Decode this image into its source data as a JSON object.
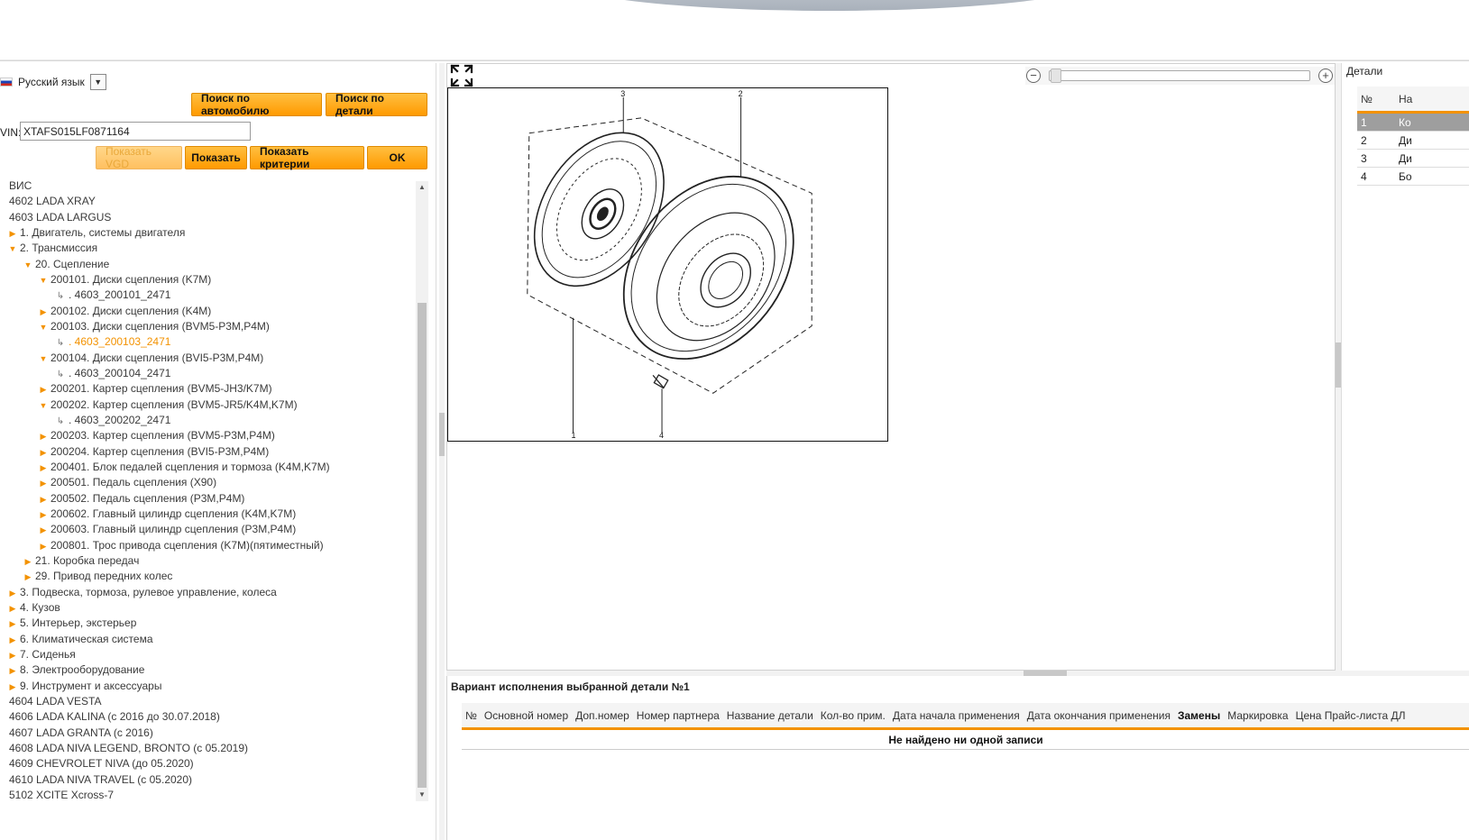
{
  "language": {
    "label": "Русский язык"
  },
  "search": {
    "by_car": "Поиск по автомобилю",
    "by_part": "Поиск по детали"
  },
  "vin": {
    "label": "VIN:",
    "value": "XTAFS015LF0871164"
  },
  "actions": {
    "show_vgd": "Показать VGD",
    "show": "Показать",
    "show_criteria": "Показать критерии",
    "ok": "OK"
  },
  "tree": {
    "items": [
      "ВИС",
      "4602 LADA XRAY",
      "4603 LADA LARGUS",
      "1. Двигатель, системы двигателя",
      "2. Трансмиссия",
      "20. Сцепление",
      "200101. Диски сцепления (K7M)",
      ". 4603_200101_2471",
      "200102. Диски сцепления (K4M)",
      "200103. Диски сцепления (BVM5-P3M,P4M)",
      ". 4603_200103_2471",
      "200104. Диски сцепления (BVI5-P3M,P4M)",
      ". 4603_200104_2471",
      "200201. Картер сцепления (BVM5-JH3/K7M)",
      "200202. Картер сцепления (BVM5-JR5/K4M,K7M)",
      ". 4603_200202_2471",
      "200203. Картер сцепления (BVM5-P3M,P4M)",
      "200204. Картер сцепления (BVI5-P3M,P4M)",
      "200401. Блок педалей сцепления и тормоза (K4M,K7M)",
      "200501. Педаль сцепления (X90)",
      "200502. Педаль сцепления (P3M,P4M)",
      "200602. Главный цилиндр сцепления (K4M,K7M)",
      "200603. Главный цилиндр сцепления (P3M,P4M)",
      "200801. Трос привода сцепления (K7M)(пятиместный)",
      "21. Коробка передач",
      "29. Привод передних колес",
      "3. Подвеска, тормоза, рулевое управление, колеса",
      "4. Кузов",
      "5. Интерьер, экстерьер",
      "6. Климатическая система",
      "7. Сиденья",
      "8. Электрооборудование",
      "9. Инструмент и аксессуары",
      "4604 LADA VESTA",
      "4606 LADA KALINA (с 2016 до 30.07.2018)",
      "4607 LADA GRANTA (с 2016)",
      "4608 LADA NIVA LEGEND, BRONTO (с 05.2019)",
      "4609 CHEVROLET NIVA (до 05.2020)",
      "4610 LADA NIVA TRAVEL (с 05.2020)",
      "5102 XCITE Xcross-7"
    ]
  },
  "zoom": {
    "minus": "−",
    "plus": "+"
  },
  "drawing": {
    "callouts": [
      "3",
      "2",
      "1",
      "4"
    ]
  },
  "details": {
    "title": "Детали",
    "header_num": "№",
    "header_name": "На",
    "rows": [
      {
        "num": "1",
        "name": "Ко"
      },
      {
        "num": "2",
        "name": "Ди"
      },
      {
        "num": "3",
        "name": "Ди"
      },
      {
        "num": "4",
        "name": "Бо"
      }
    ]
  },
  "variant": {
    "title": "Вариант исполнения выбранной детали №1",
    "columns": [
      "№",
      "Основной номер",
      "Доп.номер",
      "Номер партнера",
      "Название детали",
      "Кол-во прим.",
      "Дата начала применения",
      "Дата окончания применения",
      "Замены",
      "Маркировка",
      "Цена Прайс-листа ДЛ"
    ],
    "empty": "Не найдено ни одной записи"
  },
  "colors": {
    "accent": "#f39200",
    "selected_row": "#9e9e9e"
  }
}
